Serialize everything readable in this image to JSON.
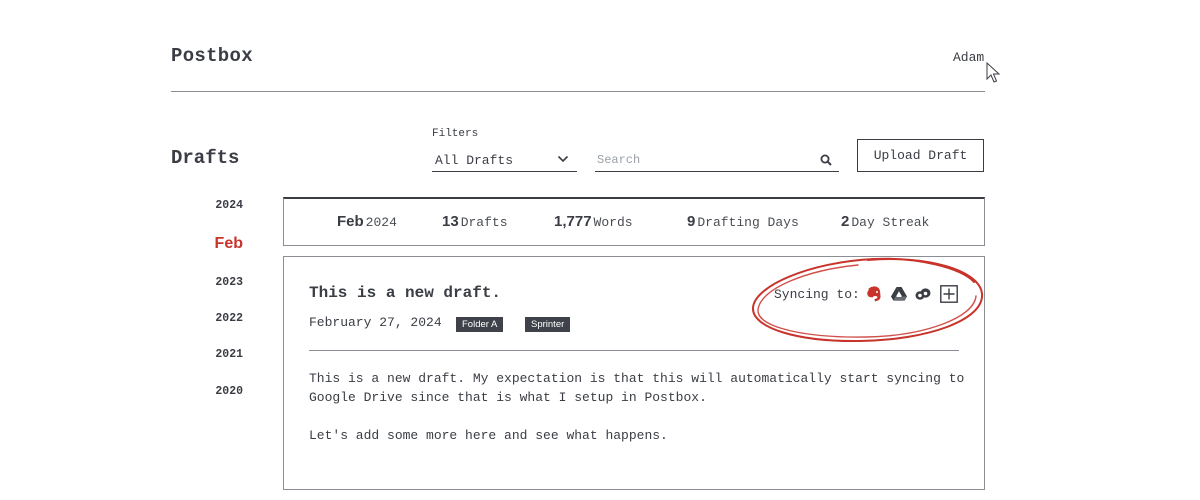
{
  "app": {
    "name": "Postbox",
    "user": "Adam"
  },
  "section_title": "Drafts",
  "filters": {
    "label": "Filters",
    "selected": "All Drafts",
    "search_placeholder": "Search",
    "upload_label": "Upload Draft"
  },
  "timeline": {
    "year_current": "2024",
    "month_active": "Feb",
    "years": [
      "2023",
      "2022",
      "2021",
      "2020"
    ]
  },
  "stats": {
    "month": "Feb",
    "year": "2024",
    "drafts_count": "13",
    "drafts_label": "Drafts",
    "words_count": "1,777",
    "words_label": "Words",
    "days_count": "9",
    "days_label": "Drafting Days",
    "streak_count": "2",
    "streak_label": "Day Streak"
  },
  "draft": {
    "title": "This is a new draft.",
    "date": "February 27, 2024",
    "tags": [
      "Folder A",
      "Sprinter"
    ],
    "syncing_label": "Syncing to:",
    "sync_targets": [
      "evernote-icon",
      "google-drive-icon",
      "dropbox-icon",
      "add-icon"
    ],
    "paragraphs": [
      "This is a new draft. My expectation is that this will automatically start syncing to Google Drive since that is what I setup in Postbox.",
      "Let's add some more here and see what happens."
    ]
  },
  "colors": {
    "text": "#3a3d44",
    "accent_red": "#c8332b",
    "tag_bg": "#3f424a",
    "rule": "#8a8d93"
  }
}
